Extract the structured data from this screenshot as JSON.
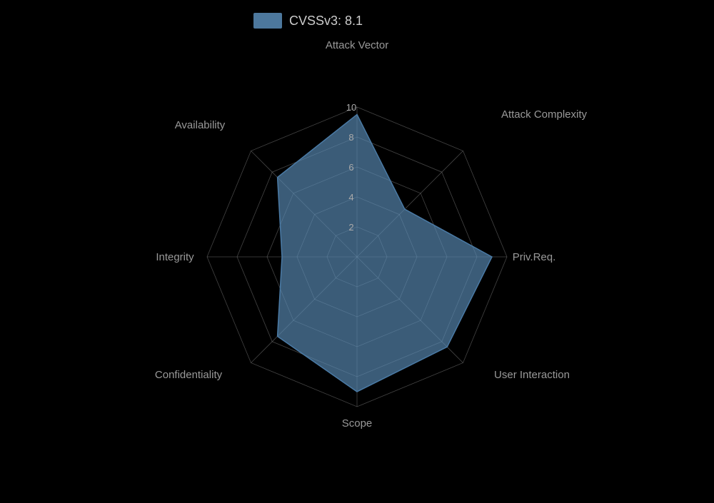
{
  "chart": {
    "title": "CVSSv3: 8.1",
    "background": "#000000",
    "accentColor": "#5b8db8",
    "axes": [
      {
        "name": "Attack Vector",
        "angle": -90,
        "value": 9.5
      },
      {
        "name": "Attack Complexity",
        "angle": -38.57,
        "value": 4.5
      },
      {
        "name": "Priv.Req.",
        "angle": 12.86,
        "value": 9.0
      },
      {
        "name": "User Interaction",
        "angle": 64.29,
        "value": 8.5
      },
      {
        "name": "Scope",
        "angle": 115.71,
        "value": 9.0
      },
      {
        "name": "Confidentiality",
        "angle": 167.14,
        "value": 7.5
      },
      {
        "name": "Integrity",
        "angle": 218.57,
        "value": 5.0
      },
      {
        "name": "Availability",
        "angle": 270,
        "value": 7.5
      }
    ],
    "scaleLabels": [
      2,
      4,
      6,
      8,
      10
    ],
    "maxValue": 10
  }
}
